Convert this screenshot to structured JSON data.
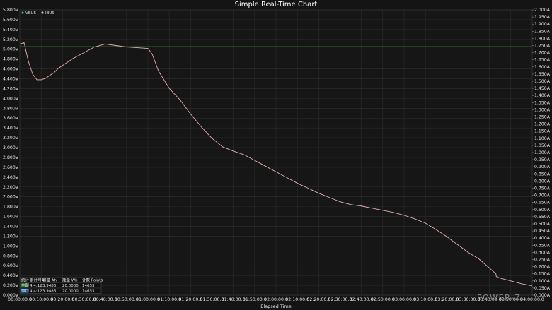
{
  "chart_data": {
    "type": "line",
    "title": "Simple Real-Time Chart",
    "xlabel": "Elapsed Time",
    "ylabel": "",
    "x_ticks": [
      "00:00:00.0",
      "00:10:00.0",
      "00:20:00.0",
      "00:30:00.0",
      "00:40:00.0",
      "00:50:00.0",
      "01:00:00.0",
      "01:10:00.0",
      "01:20:00.0",
      "01:30:00.0",
      "01:40:00.0",
      "01:50:00.0",
      "02:00:00.0",
      "02:10:00.0",
      "02:20:00.0",
      "02:30:00.0",
      "02:40:00.0",
      "02:50:00.0",
      "03:00:00.0",
      "03:10:00.0",
      "03:20:00.0",
      "03:30:00.0",
      "03:40:00.0",
      "03:50:00.0",
      "04:00:00.0"
    ],
    "x_unit": "minutes",
    "xlim": [
      0,
      240
    ],
    "ylim_left": [
      0,
      5.8
    ],
    "ylim_right": [
      0,
      2.0
    ],
    "left_ticks": [
      "0.000V",
      "0.200V",
      "0.400V",
      "0.600V",
      "0.800V",
      "1.000V",
      "1.200V",
      "1.400V",
      "1.600V",
      "1.800V",
      "2.000V",
      "2.200V",
      "2.400V",
      "2.600V",
      "2.800V",
      "3.000V",
      "3.200V",
      "3.400V",
      "3.600V",
      "3.800V",
      "4.000V",
      "4.200V",
      "4.400V",
      "4.600V",
      "4.800V",
      "5.000V",
      "5.200V",
      "5.400V",
      "5.600V",
      "5.800V"
    ],
    "right_ticks": [
      "0.000A",
      "0.050A",
      "0.100A",
      "0.150A",
      "0.200A",
      "0.250A",
      "0.300A",
      "0.350A",
      "0.400A",
      "0.450A",
      "0.500A",
      "0.550A",
      "0.600A",
      "0.650A",
      "0.700A",
      "0.750A",
      "0.800A",
      "0.850A",
      "0.900A",
      "0.950A",
      "1.000A",
      "1.050A",
      "1.100A",
      "1.150A",
      "1.200A",
      "1.250A",
      "1.300A",
      "1.350A",
      "1.400A",
      "1.450A",
      "1.500A",
      "1.550A",
      "1.600A",
      "1.650A",
      "1.700A",
      "1.750A",
      "1.800A",
      "1.850A",
      "1.900A",
      "1.950A",
      "2.000A"
    ],
    "grid": true,
    "legend_position": "top-left",
    "series": [
      {
        "name": "VBUS",
        "axis": "left",
        "color": "#4caf50",
        "x": [
          0,
          240
        ],
        "y": [
          5.05,
          5.05
        ]
      },
      {
        "name": "IBUS",
        "axis": "right",
        "color": "#e8b0b0",
        "x": [
          0,
          2,
          4,
          6,
          8,
          10,
          12,
          14,
          16,
          18,
          20,
          25,
          30,
          35,
          40,
          45,
          50,
          55,
          60,
          62,
          65,
          70,
          75,
          80,
          85,
          90,
          95,
          100,
          105,
          110,
          115,
          120,
          125,
          130,
          135,
          140,
          145,
          150,
          155,
          160,
          165,
          170,
          175,
          180,
          185,
          190,
          195,
          200,
          205,
          210,
          215,
          220,
          223,
          223.2,
          225,
          230,
          235,
          240
        ],
        "y": [
          1.76,
          1.77,
          1.64,
          1.55,
          1.51,
          1.51,
          1.52,
          1.54,
          1.56,
          1.59,
          1.61,
          1.66,
          1.7,
          1.74,
          1.76,
          1.75,
          1.74,
          1.735,
          1.73,
          1.69,
          1.57,
          1.45,
          1.37,
          1.27,
          1.18,
          1.1,
          1.04,
          1.01,
          0.985,
          0.945,
          0.905,
          0.865,
          0.825,
          0.785,
          0.75,
          0.715,
          0.685,
          0.655,
          0.635,
          0.625,
          0.61,
          0.595,
          0.58,
          0.56,
          0.535,
          0.505,
          0.46,
          0.41,
          0.355,
          0.3,
          0.255,
          0.19,
          0.15,
          0.13,
          0.12,
          0.1,
          0.08,
          0.065
        ]
      }
    ]
  },
  "stats": {
    "header": [
      "统计",
      "累计时间",
      "容量 Ah",
      "能量 Wh",
      "计数 Points"
    ],
    "rows": [
      {
        "label": "全部",
        "label_color": "#2e7d32",
        "values": [
          "4:4:12",
          "3.9486",
          "20.0000",
          "14653"
        ]
      },
      {
        "label": "窗口",
        "label_color": "#1565c0",
        "values": [
          "4:4:12",
          "3.9486",
          "20.0000",
          "14653"
        ]
      }
    ]
  },
  "brand": "POWER-Z"
}
